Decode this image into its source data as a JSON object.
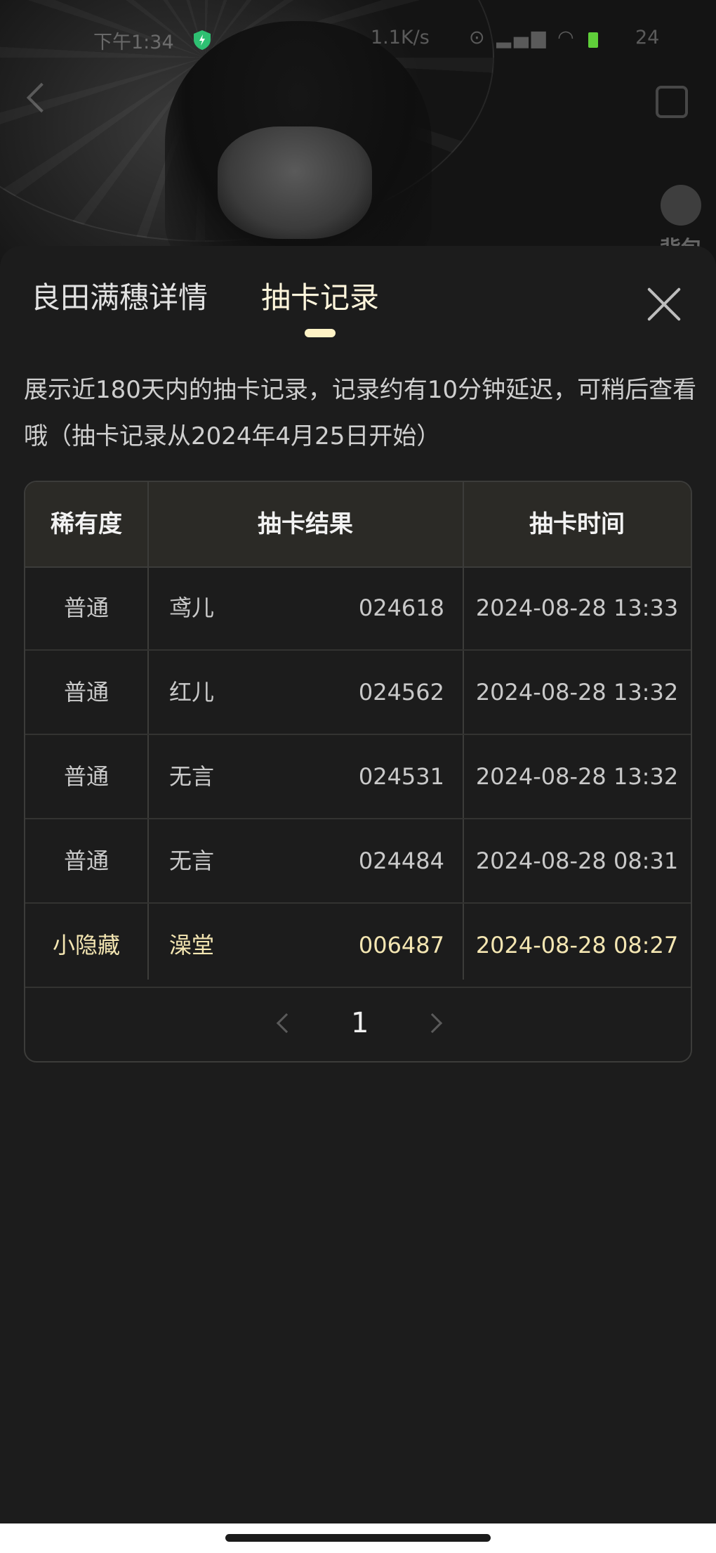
{
  "status_bar": {
    "time": "下午1:34",
    "net_speed": "1.1K/s",
    "icons_text": "⊙ ▂▄▆ ◠",
    "battery": "24"
  },
  "hero": {
    "bag_label": "背包"
  },
  "tabs": [
    {
      "label": "良田满穗详情",
      "active": false
    },
    {
      "label": "抽卡记录",
      "active": true
    }
  ],
  "notice": "展示近180天内的抽卡记录，记录约有10分钟延迟，可稍后查看哦（抽卡记录从2024年4月25日开始）",
  "table": {
    "headers": [
      "稀有度",
      "抽卡结果",
      "抽卡时间"
    ],
    "rows": [
      {
        "rarity": "普通",
        "name": "鸢儿",
        "number": "024618",
        "time": "2024-08-28 13:33",
        "highlight": false
      },
      {
        "rarity": "普通",
        "name": "红儿",
        "number": "024562",
        "time": "2024-08-28 13:32",
        "highlight": false
      },
      {
        "rarity": "普通",
        "name": "无言",
        "number": "024531",
        "time": "2024-08-28 13:32",
        "highlight": false
      },
      {
        "rarity": "普通",
        "name": "无言",
        "number": "024484",
        "time": "2024-08-28 08:31",
        "highlight": false
      },
      {
        "rarity": "小隐藏",
        "name": "澡堂",
        "number": "006487",
        "time": "2024-08-28 08:27",
        "highlight": true
      }
    ]
  },
  "pagination": {
    "current_page": "1"
  },
  "colors": {
    "accent": "#fff3c6",
    "highlight_text": "#f4e6b2",
    "header_bg": "#2b2a26",
    "background": "#1c1c1c"
  }
}
